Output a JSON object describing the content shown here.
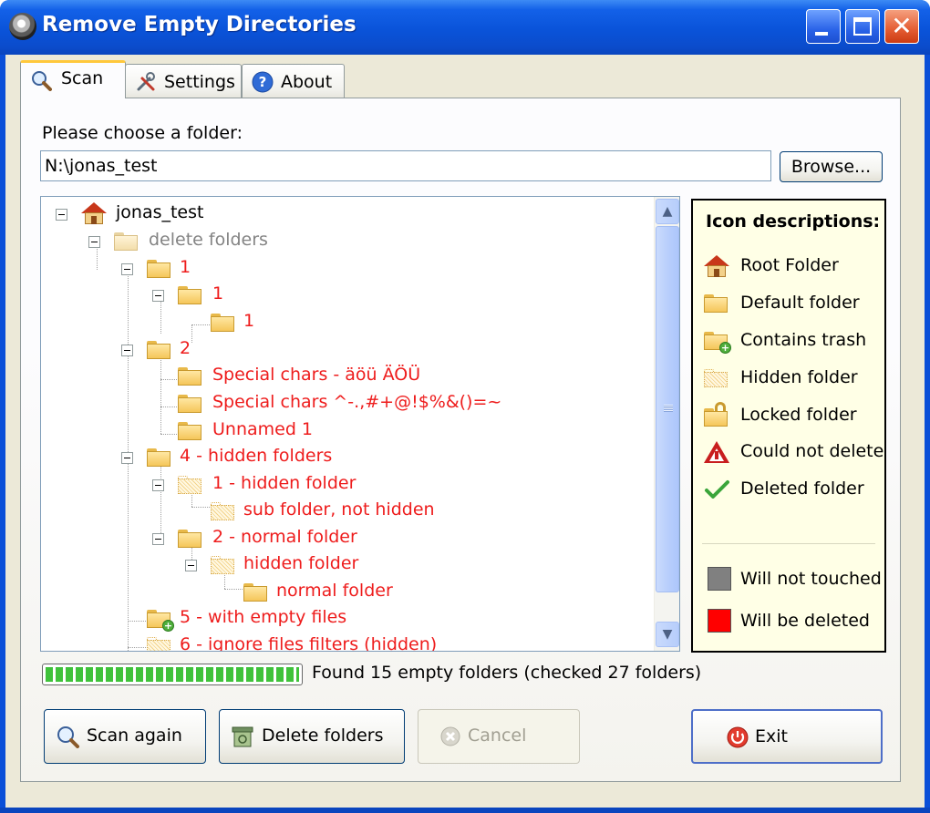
{
  "window": {
    "title": "Remove Empty Directories"
  },
  "tabs": [
    {
      "label": "Scan",
      "icon": "magnifier-icon",
      "active": true
    },
    {
      "label": "Settings",
      "icon": "tools-icon",
      "active": false
    },
    {
      "label": "About",
      "icon": "help-icon",
      "active": false
    }
  ],
  "scan": {
    "choose_label": "Please choose a folder:",
    "path_value": "N:\\jonas_test",
    "browse_label": "Browse..."
  },
  "tree": {
    "items": [
      {
        "label": "jonas_test",
        "icon": "root-folder-icon",
        "color": "black"
      },
      {
        "label": "delete folders",
        "icon": "folder-icon",
        "color": "grey"
      },
      {
        "label": "1",
        "icon": "folder-icon",
        "color": "red"
      },
      {
        "label": "1",
        "icon": "folder-icon",
        "color": "red"
      },
      {
        "label": "1",
        "icon": "folder-icon",
        "color": "red"
      },
      {
        "label": "2",
        "icon": "folder-icon",
        "color": "red"
      },
      {
        "label": "Special chars - äöü ÄÖÜ",
        "icon": "folder-icon",
        "color": "red"
      },
      {
        "label": "Special chars ^-.,#+@!$%&()=~",
        "icon": "folder-icon",
        "color": "red"
      },
      {
        "label": "Unnamed 1",
        "icon": "folder-icon",
        "color": "red"
      },
      {
        "label": "4 - hidden folders",
        "icon": "folder-icon",
        "color": "red"
      },
      {
        "label": "1 - hidden folder",
        "icon": "hidden-folder-icon",
        "color": "red"
      },
      {
        "label": "sub folder, not hidden",
        "icon": "hidden-folder-icon",
        "color": "red"
      },
      {
        "label": "2 - normal folder",
        "icon": "folder-icon",
        "color": "red"
      },
      {
        "label": "hidden folder",
        "icon": "hidden-folder-icon",
        "color": "red"
      },
      {
        "label": "normal folder",
        "icon": "folder-icon",
        "color": "red"
      },
      {
        "label": "5 - with empty files",
        "icon": "trash-folder-icon",
        "color": "red"
      },
      {
        "label": "6 - ignore files filters (hidden)",
        "icon": "hidden-folder-icon",
        "color": "red"
      }
    ]
  },
  "legend": {
    "title": "Icon descriptions:",
    "items": [
      {
        "label": "Root Folder",
        "icon": "root-folder-icon"
      },
      {
        "label": "Default folder",
        "icon": "folder-icon"
      },
      {
        "label": "Contains trash",
        "icon": "trash-folder-icon"
      },
      {
        "label": "Hidden folder",
        "icon": "hidden-folder-icon"
      },
      {
        "label": "Locked folder",
        "icon": "locked-folder-icon"
      },
      {
        "label": "Could not delete",
        "icon": "warning-icon"
      },
      {
        "label": "Deleted folder",
        "icon": "checkmark-icon"
      }
    ],
    "colors": [
      {
        "label": "Will not touched",
        "color": "#808080"
      },
      {
        "label": "Will be deleted",
        "color": "#ff0000"
      }
    ]
  },
  "status": {
    "progress_percent": 100,
    "text": "Found 15 empty folders (checked 27 folders)"
  },
  "buttons": {
    "scan_again": "Scan again",
    "delete_folders": "Delete folders",
    "cancel": "Cancel",
    "exit": "Exit"
  },
  "colors": {
    "delete_red": "#ee1c1c",
    "untouched_grey": "#848484",
    "titlebar_blue": "#0a53d9"
  }
}
